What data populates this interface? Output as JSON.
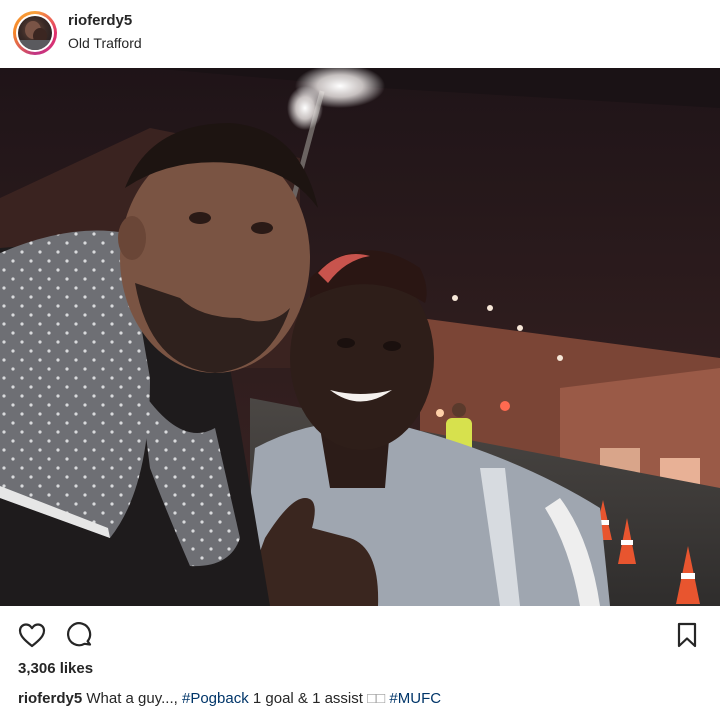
{
  "post": {
    "username": "rioferdy5",
    "location": "Old Trafford",
    "likes": "3,306 likes",
    "caption": {
      "username": "rioferdy5",
      "text_1": "What a guy...,",
      "hashtag_1": "#Pogback",
      "text_2": "1 goal & 1 assist",
      "emoji": "□□",
      "hashtag_2": "#MUFC"
    }
  },
  "icons": {
    "like": "heart-icon",
    "comment": "comment-icon",
    "save": "bookmark-icon"
  }
}
